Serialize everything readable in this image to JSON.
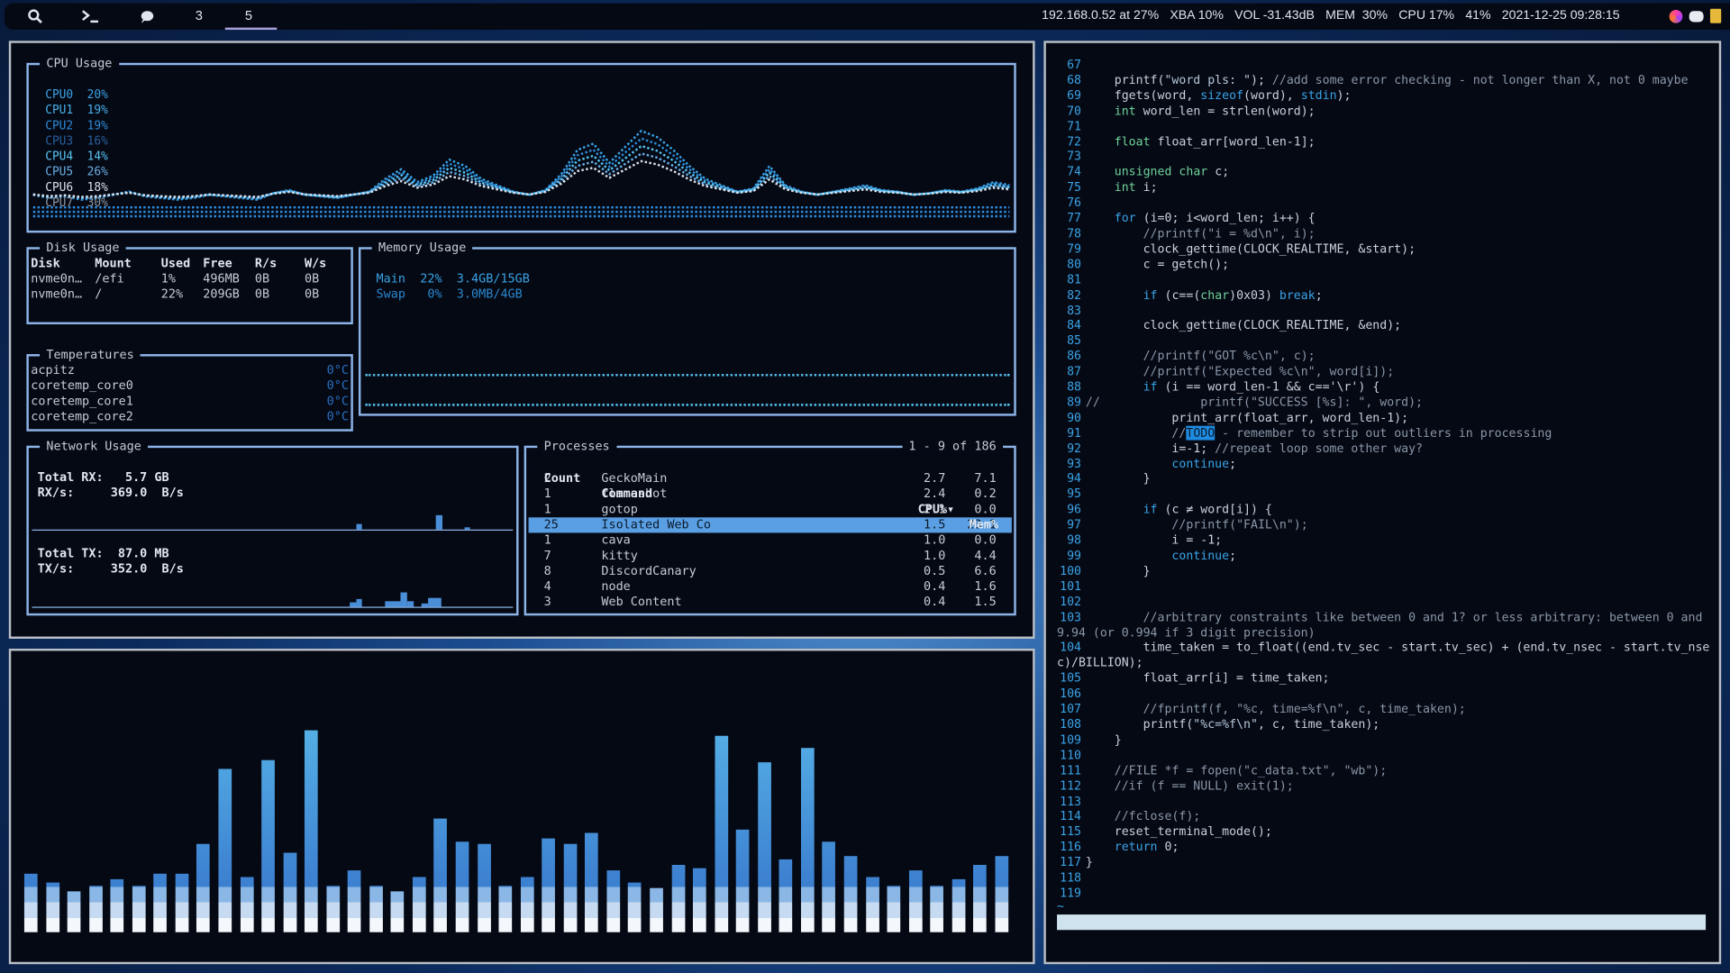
{
  "topbar": {
    "icons": [
      "search-icon",
      "terminal-icon",
      "chat-icon"
    ],
    "workspaces": [
      "3",
      "5"
    ],
    "active_workspace": "5",
    "status": [
      "192.168.0.52 at 27%",
      "XBA 10%",
      "VOL -31.43dB",
      "MEM  30%",
      "CPU 17%",
      "41%",
      "2021-12-25 09:28:15"
    ],
    "tray_icons": [
      "color-circle-icon",
      "discord-icon",
      "clipboard-icon"
    ]
  },
  "colors": {
    "accent": "#8db4e8",
    "selection": "#5a9fe3",
    "workspace_underline": "#a99ed6"
  },
  "cpu": {
    "title": "CPU Usage",
    "cores": [
      {
        "label": "CPU0",
        "value": "20%",
        "color": "#3aa3e6"
      },
      {
        "label": "CPU1",
        "value": "19%",
        "color": "#48b0ea"
      },
      {
        "label": "CPU2",
        "value": "19%",
        "color": "#2c8ad8"
      },
      {
        "label": "CPU3",
        "value": "16%",
        "color": "#2a5f9e"
      },
      {
        "label": "CPU4",
        "value": "14%",
        "color": "#56c3f0"
      },
      {
        "label": "CPU5",
        "value": "26%",
        "color": "#6aaee6"
      },
      {
        "label": "CPU6",
        "value": "18%",
        "color": "#d8e2ec"
      },
      {
        "label": "CPU7",
        "value": "30%",
        "color": "#8d97a4"
      }
    ],
    "history": [
      12,
      10,
      11,
      9,
      10,
      12,
      14,
      11,
      10,
      9,
      10,
      12,
      11,
      10,
      9,
      13,
      15,
      12,
      11,
      10,
      12,
      14,
      22,
      28,
      20,
      24,
      34,
      30,
      22,
      18,
      14,
      12,
      15,
      25,
      40,
      44,
      32,
      42,
      52,
      48,
      40,
      30,
      22,
      18,
      14,
      16,
      30,
      18,
      14,
      12,
      14,
      16,
      18,
      15,
      14,
      12,
      13,
      15,
      14,
      16,
      20,
      18
    ]
  },
  "disk": {
    "title": "Disk Usage",
    "headers": [
      "Disk",
      "Mount",
      "Used",
      "Free",
      "R/s",
      "W/s"
    ],
    "rows": [
      [
        "nvme0n…",
        "/efi",
        "1%",
        "496MB",
        "0B",
        "0B"
      ],
      [
        "nvme0n…",
        "/",
        "22%",
        "209GB",
        "0B",
        "0B"
      ]
    ]
  },
  "memory": {
    "title": "Memory Usage",
    "rows": [
      {
        "label": "Main",
        "pct": "22%",
        "amount": "3.4GB/15GB"
      },
      {
        "label": "Swap",
        "pct": "0%",
        "amount": "3.0MB/4GB"
      }
    ]
  },
  "temps": {
    "title": "Temperatures",
    "rows": [
      [
        "acpitz",
        "0°C"
      ],
      [
        "coretemp_core0",
        "0°C"
      ],
      [
        "coretemp_core1",
        "0°C"
      ],
      [
        "coretemp_core2",
        "0°C"
      ]
    ]
  },
  "network": {
    "title": "Network Usage",
    "rx_total_label": "Total RX:",
    "rx_total": "5.7 GB",
    "rx_rate_label": "RX/s:",
    "rx_rate": "369.0  B/s",
    "tx_total_label": "Total TX:",
    "tx_total": "87.0 MB",
    "tx_rate_label": "TX/s:",
    "tx_rate": "352.0  B/s"
  },
  "processes": {
    "title": "Processes",
    "range": "1 - 9 of 186",
    "headers": [
      "Count",
      "Command",
      "CPU%▾",
      "Mem%"
    ],
    "rows": [
      [
        "2",
        "GeckoMain",
        "2.7",
        "7.1"
      ],
      [
        "1",
        "flameshot",
        "2.4",
        "0.2"
      ],
      [
        "1",
        "gotop",
        "2.1",
        "0.0"
      ],
      [
        "25",
        "Isolated Web Co",
        "1.5",
        "23.1"
      ],
      [
        "1",
        "cava",
        "1.0",
        "0.0"
      ],
      [
        "7",
        "kitty",
        "1.0",
        "4.4"
      ],
      [
        "8",
        "DiscordCanary",
        "0.5",
        "6.6"
      ],
      [
        "4",
        "node",
        "0.4",
        "1.6"
      ],
      [
        "3",
        "Web Content",
        "0.4",
        "1.5"
      ]
    ],
    "selected_index": 3
  },
  "visualizer": {
    "levels": [
      0.2,
      0.17,
      0.14,
      0.16,
      0.18,
      0.16,
      0.2,
      0.2,
      0.3,
      0.56,
      0.19,
      0.59,
      0.27,
      0.69,
      0.16,
      0.21,
      0.16,
      0.14,
      0.19,
      0.39,
      0.31,
      0.3,
      0.16,
      0.19,
      0.32,
      0.3,
      0.34,
      0.21,
      0.17,
      0.15,
      0.23,
      0.22,
      0.67,
      0.35,
      0.58,
      0.25,
      0.63,
      0.31,
      0.26,
      0.19,
      0.16,
      0.21,
      0.16,
      0.18,
      0.23,
      0.26
    ]
  },
  "editor": {
    "lines": [
      [
        "67",
        ""
      ],
      [
        "68",
        "    printf(\"word pls: \"); //add some error checking - not longer than X, not 0 maybe"
      ],
      [
        "69",
        "    fgets(word, sizeof(word), stdin);"
      ],
      [
        "70",
        "    int word_len = strlen(word);"
      ],
      [
        "71",
        ""
      ],
      [
        "72",
        "    float float_arr[word_len-1];"
      ],
      [
        "73",
        ""
      ],
      [
        "74",
        "    unsigned char c;"
      ],
      [
        "75",
        "    int i;"
      ],
      [
        "76",
        ""
      ],
      [
        "77",
        "    for (i=0; i<word_len; i++) {"
      ],
      [
        "78",
        "        //printf(\"i = %d\\n\", i);"
      ],
      [
        "79",
        "        clock_gettime(CLOCK_REALTIME, &start);"
      ],
      [
        "80",
        "        c = getch();"
      ],
      [
        "81",
        ""
      ],
      [
        "82",
        "        if (c==(char)0x03) break;"
      ],
      [
        "83",
        ""
      ],
      [
        "84",
        "        clock_gettime(CLOCK_REALTIME, &end);"
      ],
      [
        "85",
        ""
      ],
      [
        "86",
        "        //printf(\"GOT %c\\n\", c);"
      ],
      [
        "87",
        "        //printf(\"Expected %c\\n\", word[i]);"
      ],
      [
        "88",
        "        if (i == word_len-1 && c=='\\r') {"
      ],
      [
        "89",
        "//              printf(\"SUCCESS [%s]: \", word);"
      ],
      [
        "90",
        "            print_arr(float_arr, word_len-1);"
      ],
      [
        "91",
        "            //TODO - remember to strip out outliers in processing"
      ],
      [
        "92",
        "            i=-1; //repeat loop some other way?"
      ],
      [
        "93",
        "            continue;"
      ],
      [
        "94",
        "        }"
      ],
      [
        "95",
        ""
      ],
      [
        "96",
        "        if (c ≠ word[i]) {"
      ],
      [
        "97",
        "            //printf(\"FAIL\\n\");"
      ],
      [
        "98",
        "            i = -1;"
      ],
      [
        "99",
        "            continue;"
      ],
      [
        "100",
        "        }"
      ],
      [
        "101",
        ""
      ],
      [
        "102",
        ""
      ],
      [
        "103",
        "        //arbitrary constraints like between 0 and 1? or less arbitrary: between 0 and 9.94 (or 0.994 if 3 digit precision)"
      ],
      [
        "104",
        "        time_taken = to_float((end.tv_sec - start.tv_sec) + (end.tv_nsec - start.tv_nsec)/BILLION);"
      ],
      [
        "105",
        "        float_arr[i] = time_taken;"
      ],
      [
        "106",
        ""
      ],
      [
        "107",
        "        //fprintf(f, \"%c, time=%f\\n\", c, time_taken);"
      ],
      [
        "108",
        "        printf(\"%c=%f\\n\", c, time_taken);"
      ],
      [
        "109",
        "    }"
      ],
      [
        "110",
        ""
      ],
      [
        "111",
        "    //FILE *f = fopen(\"c_data.txt\", \"wb\");"
      ],
      [
        "112",
        "    //if (f == NULL) exit(1);"
      ],
      [
        "113",
        ""
      ],
      [
        "114",
        "    //fclose(f);"
      ],
      [
        "115",
        "    reset_terminal_mode();"
      ],
      [
        "116",
        "    return 0;"
      ],
      [
        "117",
        "}"
      ],
      [
        "118",
        ""
      ],
      [
        "119",
        ""
      ]
    ],
    "tilde": "~"
  }
}
